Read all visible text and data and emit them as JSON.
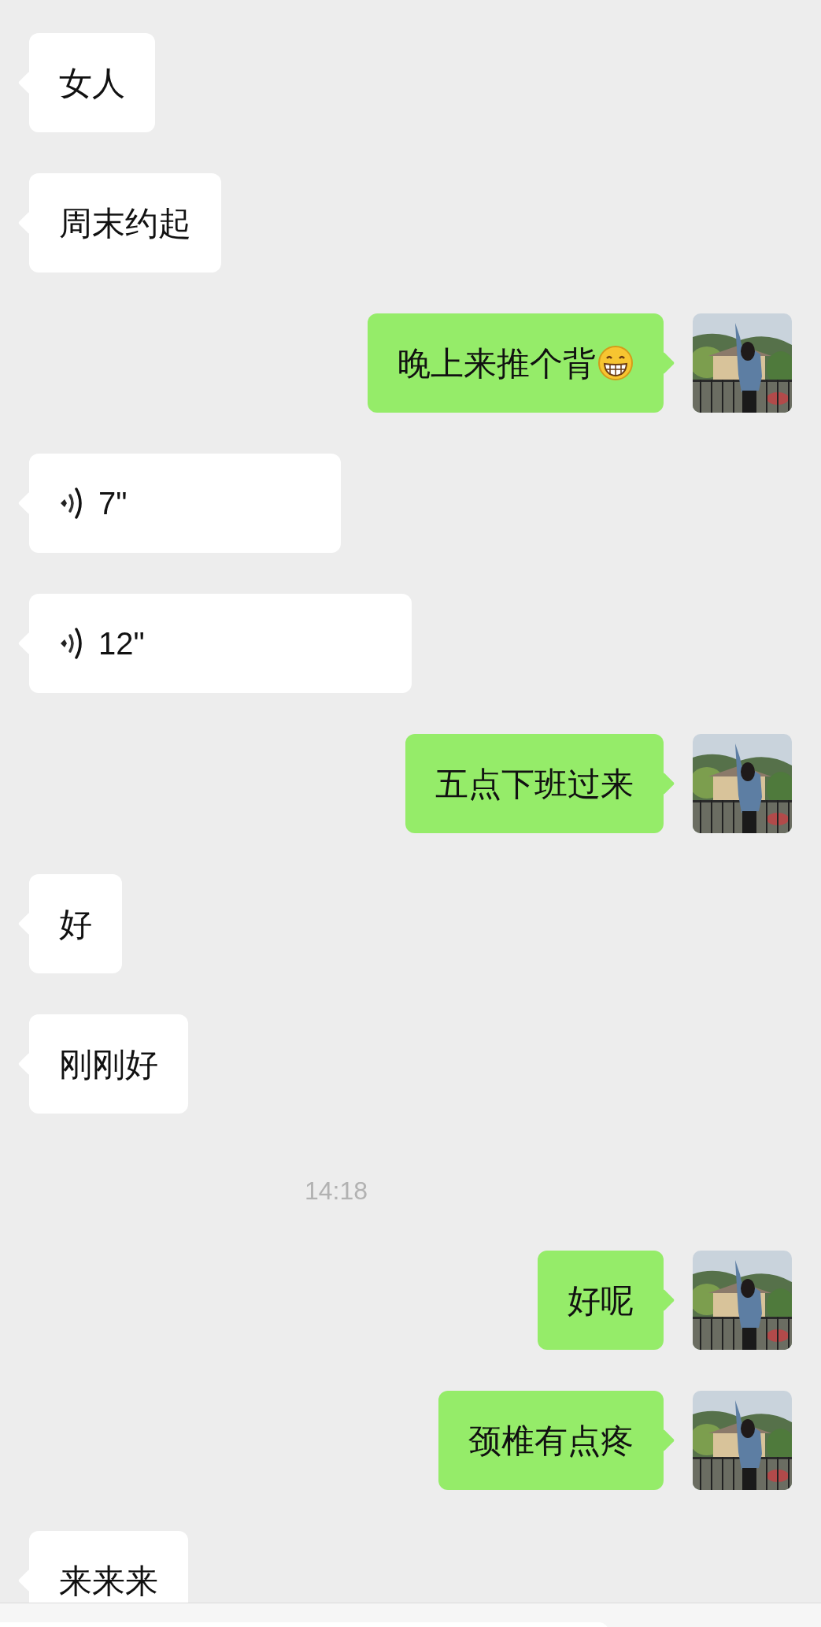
{
  "messages": [
    {
      "kind": "incoming",
      "text": "女人"
    },
    {
      "kind": "incoming",
      "text": "周末约起"
    },
    {
      "kind": "outgoing",
      "text": "晚上来推个背",
      "with_emoji": true
    },
    {
      "kind": "incoming_voice",
      "duration": "7\""
    },
    {
      "kind": "incoming_voice",
      "duration": "12\""
    },
    {
      "kind": "outgoing",
      "text": "五点下班过来"
    },
    {
      "kind": "incoming",
      "text": "好"
    },
    {
      "kind": "incoming",
      "text": "刚刚好"
    },
    {
      "kind": "time",
      "text": "14:18"
    },
    {
      "kind": "outgoing",
      "text": "好呢"
    },
    {
      "kind": "outgoing",
      "text": "颈椎有点疼"
    },
    {
      "kind": "incoming",
      "text": "来来来"
    }
  ]
}
